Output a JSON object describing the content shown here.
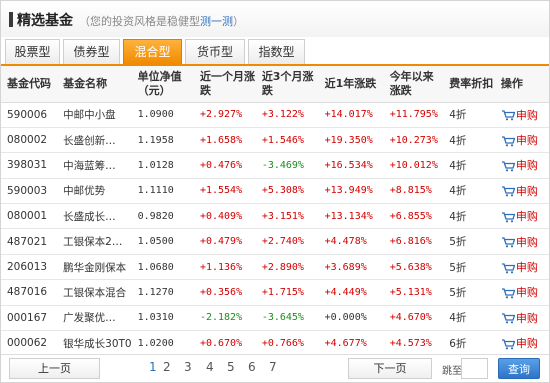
{
  "header": {
    "title": "精选基金",
    "subtitle_prefix": "（您的投资风格是稳健型",
    "subtitle_link": "测一测",
    "subtitle_suffix": "）"
  },
  "tabs": [
    "股票型",
    "债券型",
    "混合型",
    "货币型",
    "指数型"
  ],
  "active_tab": "混合型",
  "columns": {
    "code": "基金代码",
    "name": "基金名称",
    "nav": "单位净值（元）",
    "m1": "近一个月涨跌",
    "m3": "近3个月涨跌",
    "y1": "近1年涨跌",
    "ytd": "今年以来涨跌",
    "fee": "费率折扣",
    "op": "操作"
  },
  "rows": [
    {
      "code": "590006",
      "name": "中邮中小盘",
      "nav": "1.0900",
      "m1": "+2.927%",
      "m3": "+3.122%",
      "y1": "+14.017%",
      "ytd": "+11.795%",
      "fee": "4折",
      "op": "申购"
    },
    {
      "code": "080002",
      "name": "长盛创新…",
      "nav": "1.1958",
      "m1": "+1.658%",
      "m3": "+1.546%",
      "y1": "+19.350%",
      "ytd": "+10.273%",
      "fee": "4折",
      "op": "申购"
    },
    {
      "code": "398031",
      "name": "中海蓝筹…",
      "nav": "1.0128",
      "m1": "+0.476%",
      "m3": "-3.469%",
      "y1": "+16.534%",
      "ytd": "+10.012%",
      "fee": "4折",
      "op": "申购"
    },
    {
      "code": "590003",
      "name": "中邮优势",
      "nav": "1.1110",
      "m1": "+1.554%",
      "m3": "+5.308%",
      "y1": "+13.949%",
      "ytd": "+8.815%",
      "fee": "4折",
      "op": "申购"
    },
    {
      "code": "080001",
      "name": "长盛成长…",
      "nav": "0.9820",
      "m1": "+0.409%",
      "m3": "+3.151%",
      "y1": "+13.134%",
      "ytd": "+6.855%",
      "fee": "4折",
      "op": "申购"
    },
    {
      "code": "487021",
      "name": "工银保本2…",
      "nav": "1.0500",
      "m1": "+0.479%",
      "m3": "+2.740%",
      "y1": "+4.478%",
      "ytd": "+6.816%",
      "fee": "5折",
      "op": "申购"
    },
    {
      "code": "206013",
      "name": "鹏华金刚保本",
      "nav": "1.0680",
      "m1": "+1.136%",
      "m3": "+2.890%",
      "y1": "+3.689%",
      "ytd": "+5.638%",
      "fee": "5折",
      "op": "申购"
    },
    {
      "code": "487016",
      "name": "工银保本混合",
      "nav": "1.1270",
      "m1": "+0.356%",
      "m3": "+1.715%",
      "y1": "+4.449%",
      "ytd": "+5.131%",
      "fee": "5折",
      "op": "申购"
    },
    {
      "code": "000167",
      "name": "广发聚优…",
      "nav": "1.0310",
      "m1": "-2.182%",
      "m3": "-3.645%",
      "y1": "+0.000%",
      "ytd": "+4.670%",
      "fee": "4折",
      "op": "申购"
    },
    {
      "code": "000062",
      "name": "银华成长30T0",
      "nav": "1.0200",
      "m1": "+0.670%",
      "m3": "+0.766%",
      "y1": "+4.677%",
      "ytd": "+4.573%",
      "fee": "6折",
      "op": "申购"
    }
  ],
  "pager": {
    "prev": "上一页",
    "pages": [
      "1",
      "2",
      "3",
      "4",
      "5",
      "6",
      "7"
    ],
    "current": "1",
    "next": "下一页",
    "jump_label": "跳至",
    "query": "查询"
  },
  "colors": {
    "accent": "#f08a00",
    "up": "#d40000",
    "down": "#1a8f1a",
    "link": "#2f6fbd"
  }
}
